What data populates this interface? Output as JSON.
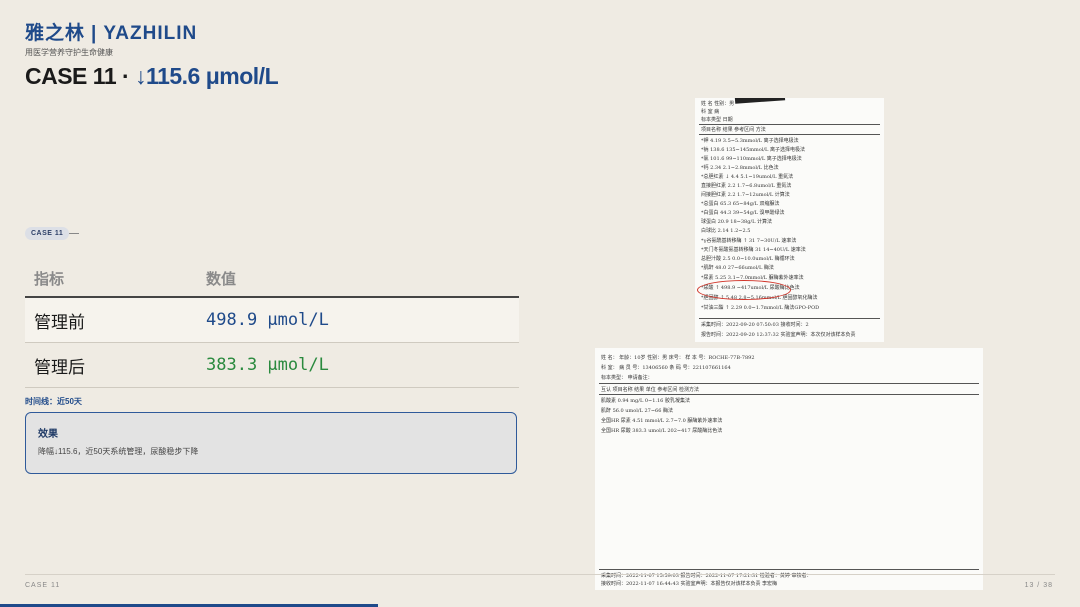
{
  "header": {
    "brand_cn": "雅之林",
    "brand_sep": "|",
    "brand_en": "YAZHILIN",
    "tagline": "用医学营养守护生命健康",
    "title_prefix": "CASE 11 · ",
    "title_accent": "↓115.6 μmol/L"
  },
  "case_tag": "CASE 11",
  "table": {
    "col_indicator": "指标",
    "col_value": "数值",
    "rows": [
      {
        "label": "管理前",
        "value": "498.9 μmol/L"
      },
      {
        "label": "管理后",
        "value": "383.3 μmol/L"
      }
    ]
  },
  "timeline": "时间线：近50天",
  "effect": {
    "heading": "效果",
    "text": "降幅↓115.6，近50天系统管理，尿酸稳步下降"
  },
  "report1": {
    "lines": [
      {
        "k": "h1",
        "t": "姓    名           性别：男"
      },
      {
        "k": "h2",
        "t": "科    室                病"
      },
      {
        "k": "h3",
        "t": "标本类型                 日期"
      },
      {
        "k": "cols",
        "t": "项目名称         结果    参考区间       方法"
      },
      {
        "k": "r1",
        "t": "*钾           4.19   3.5~5.3mmol/L   离子选择电极法"
      },
      {
        "k": "r2",
        "t": "*钠           138.6  135~145mmol/L   离子选择电极法"
      },
      {
        "k": "r3",
        "t": "*氯           101.6  99~110mmol/L    离子选择电极法"
      },
      {
        "k": "r4",
        "t": "*钙           2.34   2.1~2.8mmol/L   比色法"
      },
      {
        "k": "r5",
        "t": "*总胆红素   ↓ 4.4    5.1~19umol/L    重氮法"
      },
      {
        "k": "r6",
        "t": "  直接胆红素    2.2    1.7~6.8umol/L   重氮法"
      },
      {
        "k": "r7",
        "t": "  间接胆红素    2.2    1.7~12umol/L    计算法"
      },
      {
        "k": "r8",
        "t": "*总蛋白        65.3   65~84g/L        双缩脲法"
      },
      {
        "k": "r9",
        "t": "*白蛋白        44.3   39~54g/L        溴甲酚绿法"
      },
      {
        "k": "r10",
        "t": "  球蛋白        20.9   18~38g/L        计算法"
      },
      {
        "k": "r11",
        "t": "  白球比        2.14   1.2~2.5"
      },
      {
        "k": "r12",
        "t": "*γ谷氨酰基转移酶 ↑ 31  7~30U/L        速率法"
      },
      {
        "k": "r13",
        "t": "*天门冬氨酸氨基转移酶 31  14~40U/L     速率法"
      },
      {
        "k": "r14",
        "t": "  总胆汁酸      2.5    0.0~10.0umol/L  酶循环法"
      },
      {
        "k": "r15",
        "t": "*肌酐          48.0   27~66umol/L     酶法"
      },
      {
        "k": "r16",
        "t": "*尿素          5.25   3.1~7.0mmol/L   脲酶紫外速率法"
      },
      {
        "k": "r17",
        "t": "*尿酸        ↑ 498.9  ~417umol/L      尿酸酶比色法"
      },
      {
        "k": "r18",
        "t": "*胆固醇      ↑ 5.48   2.8~5.16mmol/L  胆固醇氧化酶法"
      },
      {
        "k": "r19",
        "t": "*甘油三酯    ↑ 2.29   0.0~1.7mmol/L   酶法GPO-POD"
      },
      {
        "k": "f1",
        "t": "采集时间：2022-09-20 07:50:03         接收时间：2"
      },
      {
        "k": "f2",
        "t": "报告时间：2022-09-20 12:37:32  实验室声明：本次仅对该样本负责"
      }
    ]
  },
  "report2": {
    "lines": [
      {
        "k": "h1",
        "t": "姓    名：         年龄：10岁        性别：男    床号：          样 本 号：ROCHE-77B-7892"
      },
      {
        "k": "h2",
        "t": "科    室：                          病 员 号：13406560             条 码 号：221107661164"
      },
      {
        "k": "h3",
        "t": "标本类型：                                                          申请备注："
      },
      {
        "k": "cols",
        "t": "互认   项目名称                     结果          单位           参考区间          检测方法"
      },
      {
        "k": "r1",
        "t": "       肌酸素                       0.94          mg/L           0~1.16            胶乳凝集法"
      },
      {
        "k": "r2",
        "t": "       肌酐                         56.0          umol/L         27~66             酶法"
      },
      {
        "k": "r3",
        "t": "全国HR  尿素                         4.51          mmol/L         2.7~7.0           脲酶紫外速率法"
      },
      {
        "k": "r4",
        "t": "全国HR  尿酸                         383.3         umol/L         202~417           尿酸酶比色法"
      },
      {
        "k": "f1",
        "t": "采集时间：2022-11-07 15:59:03   报告时间：2022-11-07 17:21:31        检验者：黄婷           审核者："
      },
      {
        "k": "f2",
        "t": "接收时间：2022-11-07 16:44:43   实验室声明：本报告仅对该样本负责                                  李宏梅"
      }
    ]
  },
  "footer": {
    "left": "CASE 11",
    "right": "13 / 38",
    "progress": 0.35
  }
}
